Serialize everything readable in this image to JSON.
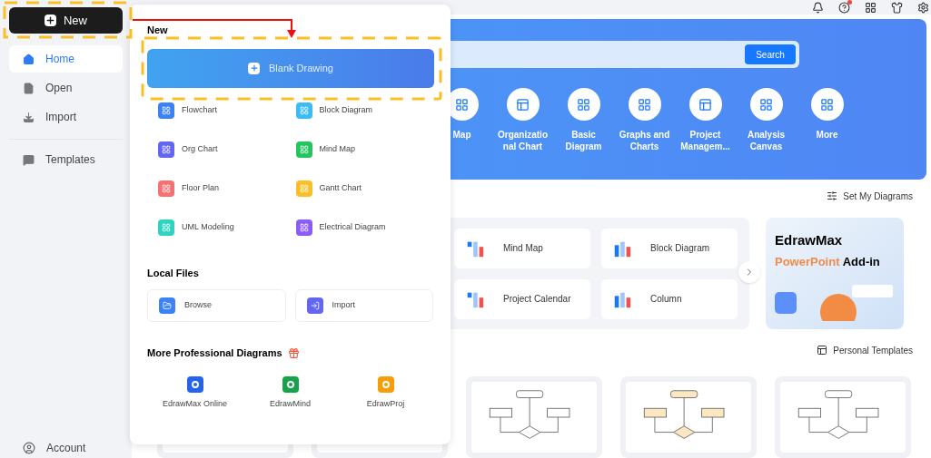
{
  "sidebar": {
    "new_button": "New",
    "items": [
      {
        "label": "Home",
        "selected": true
      },
      {
        "label": "Open",
        "selected": false
      },
      {
        "label": "Import",
        "selected": false
      },
      {
        "label": "Templates",
        "selected": false
      }
    ],
    "account": "Account"
  },
  "banner": {
    "search_button": "Search",
    "categories": [
      {
        "lines": [
          "Map"
        ]
      },
      {
        "lines": [
          "Organizatio",
          "nal Chart"
        ]
      },
      {
        "lines": [
          "Basic",
          "Diagram"
        ]
      },
      {
        "lines": [
          "Graphs and",
          "Charts"
        ]
      },
      {
        "lines": [
          "Project",
          "Managem..."
        ]
      },
      {
        "lines": [
          "Analysis",
          "Canvas"
        ]
      },
      {
        "lines": [
          "More"
        ]
      }
    ]
  },
  "set_my_diagrams": "Set My Diagrams",
  "recent": [
    "Mind Map",
    "Block Diagram",
    "Project Calendar",
    "Column"
  ],
  "promo": {
    "title": "EdrawMax",
    "highlight": "PowerPoint",
    "rest": "Add-in"
  },
  "personal_templates": "Personal Templates",
  "new_panel": {
    "heading": "New",
    "blank_button": "Blank Drawing",
    "items": [
      {
        "label": "Flowchart",
        "color": "#3b82f6"
      },
      {
        "label": "Block Diagram",
        "color": "#38bdf8"
      },
      {
        "label": "Org Chart",
        "color": "#6366f1"
      },
      {
        "label": "Mind Map",
        "color": "#22c55e"
      },
      {
        "label": "Floor Plan",
        "color": "#f87171"
      },
      {
        "label": "Gantt Chart",
        "color": "#fbbf24"
      },
      {
        "label": "UML Modeling",
        "color": "#2dd4bf"
      },
      {
        "label": "Electrical Diagram",
        "color": "#8b5cf6"
      }
    ],
    "local_heading": "Local Files",
    "local": [
      {
        "label": "Browse",
        "color": "#3b82f6"
      },
      {
        "label": "Import",
        "color": "#6366f1"
      }
    ],
    "more_heading": "More Professional Diagrams",
    "apps": [
      {
        "label": "EdrawMax Online",
        "color": "#2563eb"
      },
      {
        "label": "EdrawMind",
        "color": "#16a34a"
      },
      {
        "label": "EdrawProj",
        "color": "#f59e0b"
      }
    ]
  }
}
